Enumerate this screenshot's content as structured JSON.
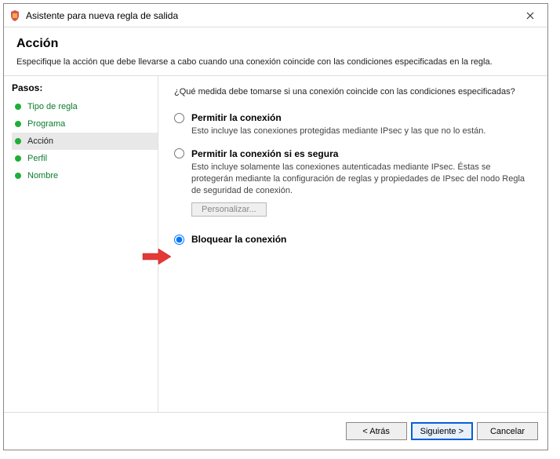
{
  "window": {
    "title": "Asistente para nueva regla de salida"
  },
  "header": {
    "title": "Acción",
    "subtitle": "Especifique la acción que debe llevarse a cabo cuando una conexión coincide con las condiciones especificadas en la regla."
  },
  "sidebar": {
    "heading": "Pasos:",
    "steps": [
      {
        "label": "Tipo de regla"
      },
      {
        "label": "Programa"
      },
      {
        "label": "Acción"
      },
      {
        "label": "Perfil"
      },
      {
        "label": "Nombre"
      }
    ]
  },
  "main": {
    "question": "¿Qué medida debe tomarse si una conexión coincide con las condiciones especificadas?",
    "options": [
      {
        "label": "Permitir la conexión",
        "desc": "Esto incluye las conexiones protegidas mediante IPsec y las que no lo están."
      },
      {
        "label": "Permitir la conexión si es segura",
        "desc": "Esto incluye solamente las conexiones autenticadas mediante IPsec. Éstas se protegerán mediante la configuración de reglas y propiedades de IPsec del nodo Regla de seguridad de conexión.",
        "customize": "Personalizar..."
      },
      {
        "label": "Bloquear la conexión"
      }
    ]
  },
  "footer": {
    "back": "< Atrás",
    "next": "Siguiente >",
    "cancel": "Cancelar"
  }
}
